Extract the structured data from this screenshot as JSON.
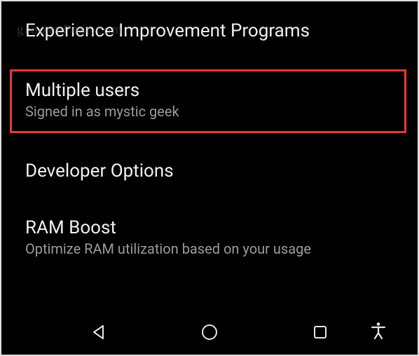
{
  "watermark": "groovyPost.com",
  "settings": {
    "items": [
      {
        "title": "Experience Improvement Programs",
        "subtitle": null,
        "highlighted": false
      },
      {
        "title": "Multiple users",
        "subtitle": "Signed in as mystic geek",
        "highlighted": true
      },
      {
        "title": "Developer Options",
        "subtitle": null,
        "highlighted": false
      },
      {
        "title": "RAM Boost",
        "subtitle": "Optimize RAM utilization based on your usage",
        "highlighted": false
      }
    ]
  },
  "nav": {
    "back": "Back",
    "home": "Home",
    "recent": "Recent Apps",
    "accessibility": "Accessibility"
  }
}
